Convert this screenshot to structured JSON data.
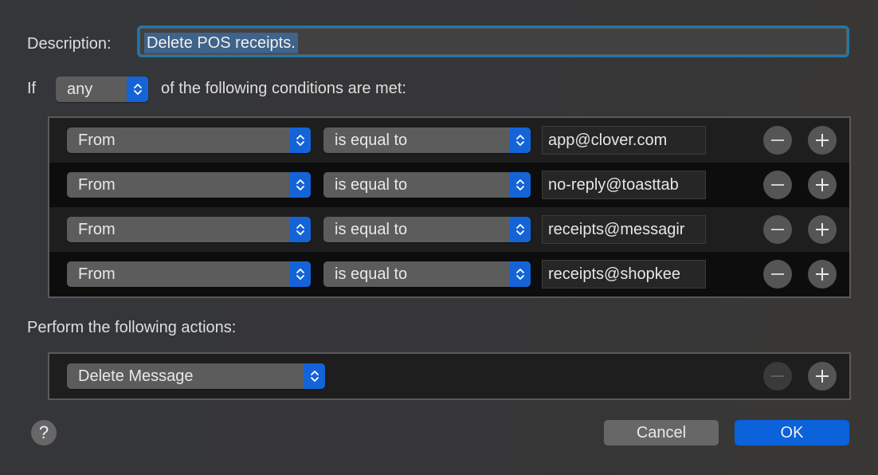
{
  "rule": {
    "description_label": "Description:",
    "description_value": "Delete POS receipts."
  },
  "conditions": {
    "if_label": "If",
    "match_mode": "any",
    "suffix_text": "of the following conditions are met:",
    "rows": [
      {
        "field": "From",
        "operator": "is equal to",
        "value": "app@clover.com"
      },
      {
        "field": "From",
        "operator": "is equal to",
        "value": "no-reply@toasttab"
      },
      {
        "field": "From",
        "operator": "is equal to",
        "value": "receipts@messagir"
      },
      {
        "field": "From",
        "operator": "is equal to",
        "value": "receipts@shopkee"
      }
    ]
  },
  "actions": {
    "label": "Perform the following actions:",
    "rows": [
      {
        "action": "Delete Message"
      }
    ]
  },
  "footer": {
    "help_label": "?",
    "cancel_label": "Cancel",
    "ok_label": "OK"
  },
  "colors": {
    "accent": "#1464d8",
    "focus_ring": "#1f78a8",
    "selection": "#3f638a"
  }
}
